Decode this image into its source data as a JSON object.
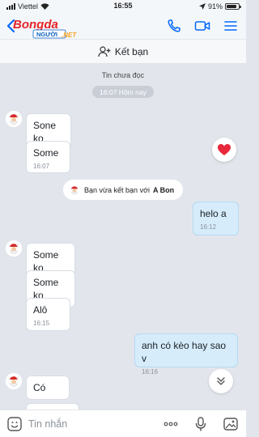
{
  "status_bar": {
    "carrier": "Viettel",
    "time": "16:55",
    "battery": "91%"
  },
  "header": {
    "logo_main": "Bongda",
    "logo_tag": "NGƯỜI",
    "logo_sub": ".NET"
  },
  "add_friend": {
    "label": "Kết bạn"
  },
  "chat": {
    "unread_label": "Tin chưa đọc",
    "time_pill": "16:07 Hôm nay",
    "system_notice": {
      "prefix": "Bạn vừa kết bạn với",
      "name": "A Bon"
    },
    "messages": [
      {
        "sender": "them",
        "text": "Sone ko"
      },
      {
        "sender": "them",
        "text": "Some",
        "time": "16:07"
      },
      {
        "sender": "me",
        "text": "helo a",
        "time": "16:12"
      },
      {
        "sender": "them",
        "text": "Some ko"
      },
      {
        "sender": "them",
        "text": "Some ko"
      },
      {
        "sender": "them",
        "text": "Alô",
        "time": "16:15"
      },
      {
        "sender": "me",
        "text": "anh có kèo hay sao v",
        "time": "16:16"
      },
      {
        "sender": "them",
        "text": "Có"
      }
    ]
  },
  "composer": {
    "placeholder": "Tin nhắn"
  },
  "colors": {
    "accent": "#0068ff",
    "bg": "#e2e6ec",
    "my_bubble": "#d6ecfb",
    "heart": "#e8293b"
  }
}
